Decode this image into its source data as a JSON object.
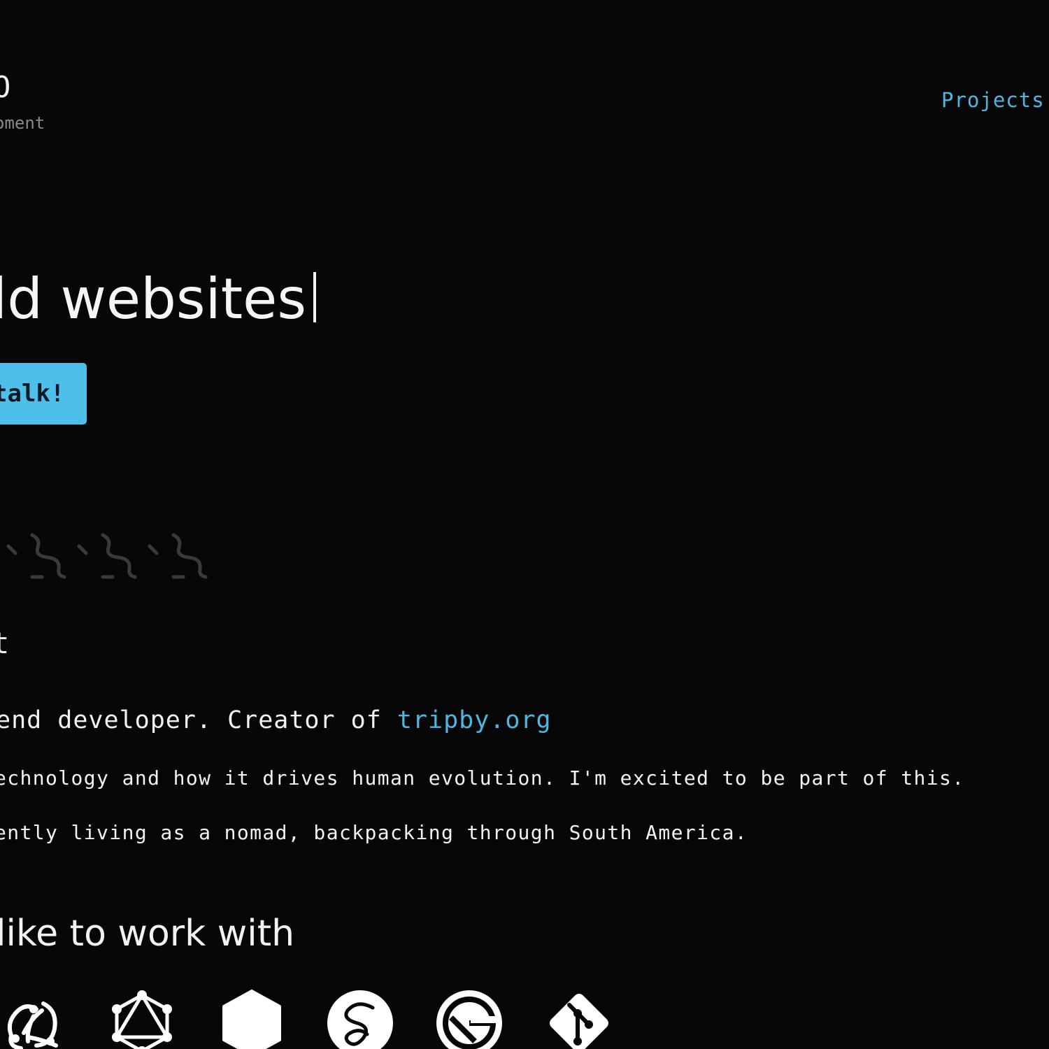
{
  "header": {
    "logo_title": "O",
    "logo_subtitle": "oment",
    "nav": {
      "projects_label": "Projects"
    }
  },
  "hero": {
    "headline": "ld websites",
    "cta_label": "talk!"
  },
  "about": {
    "heading": "t",
    "intro_text": "end developer. Creator of ",
    "intro_link": "tripby.org",
    "paragraph_1": "echnology and how it drives human evolution. I'm excited to be part of this.",
    "paragraph_2": "ently living as a nomad, backpacking through South America."
  },
  "tech": {
    "heading": "like to work with",
    "icons": [
      "redux-icon",
      "graphql-icon",
      "nodejs-hexagon-icon",
      "sass-icon",
      "gatsby-icon",
      "git-icon"
    ]
  },
  "colors": {
    "background": "#070707",
    "accent": "#4fb6e1",
    "button": "#4dbfe8",
    "text": "#f2f2f2",
    "muted": "#8a8a8a",
    "squiggle": "#3a3a3a"
  }
}
